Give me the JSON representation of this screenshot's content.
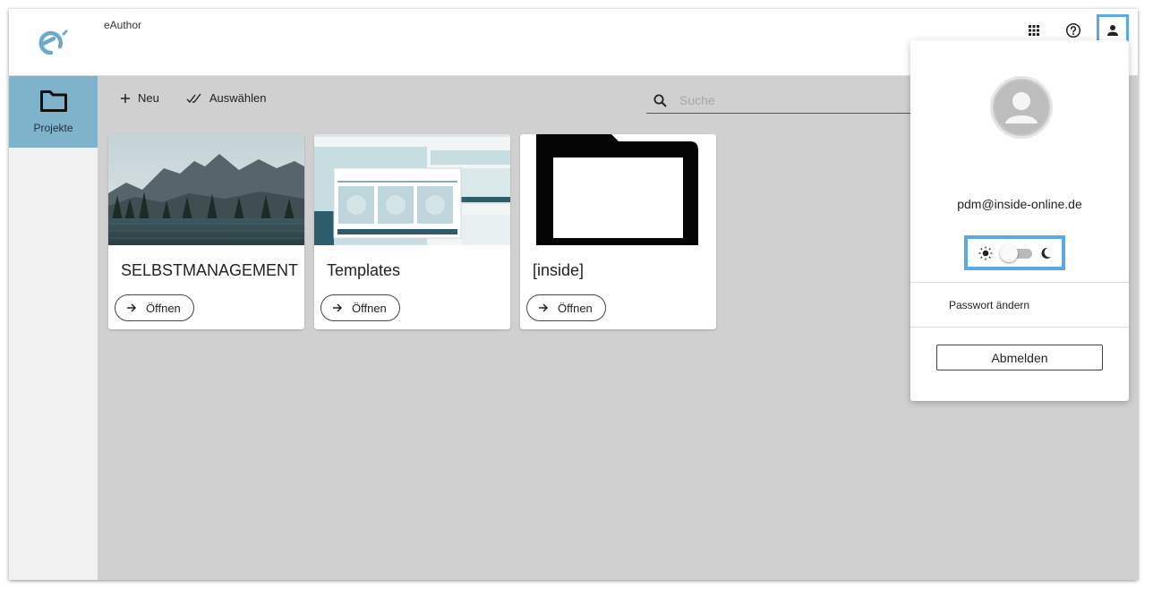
{
  "app": {
    "title": "eAuthor"
  },
  "header": {
    "icons": [
      {
        "name": "apps-grid-icon"
      },
      {
        "name": "help-icon"
      },
      {
        "name": "user-icon"
      }
    ]
  },
  "sidebar": {
    "items": [
      {
        "label": "Projekte",
        "icon": "folder-icon"
      }
    ]
  },
  "toolbar": {
    "new_label": "Neu",
    "select_label": "Auswählen"
  },
  "search": {
    "placeholder": "Suche",
    "value": ""
  },
  "projects": [
    {
      "title": "SELBSTMANAGEMENT",
      "open_label": "Öffnen"
    },
    {
      "title": "Templates",
      "open_label": "Öffnen"
    },
    {
      "title": "[inside]",
      "open_label": "Öffnen"
    }
  ],
  "user_menu": {
    "email": "pdm@inside-online.de",
    "theme_toggle": {
      "state": "light"
    },
    "change_password_label": "Passwort ändern",
    "logout_label": "Abmelden"
  },
  "colors": {
    "accent": "#5aa8e6",
    "sidebar_active": "#7fb3cc",
    "logo": "#6aa9c9"
  }
}
